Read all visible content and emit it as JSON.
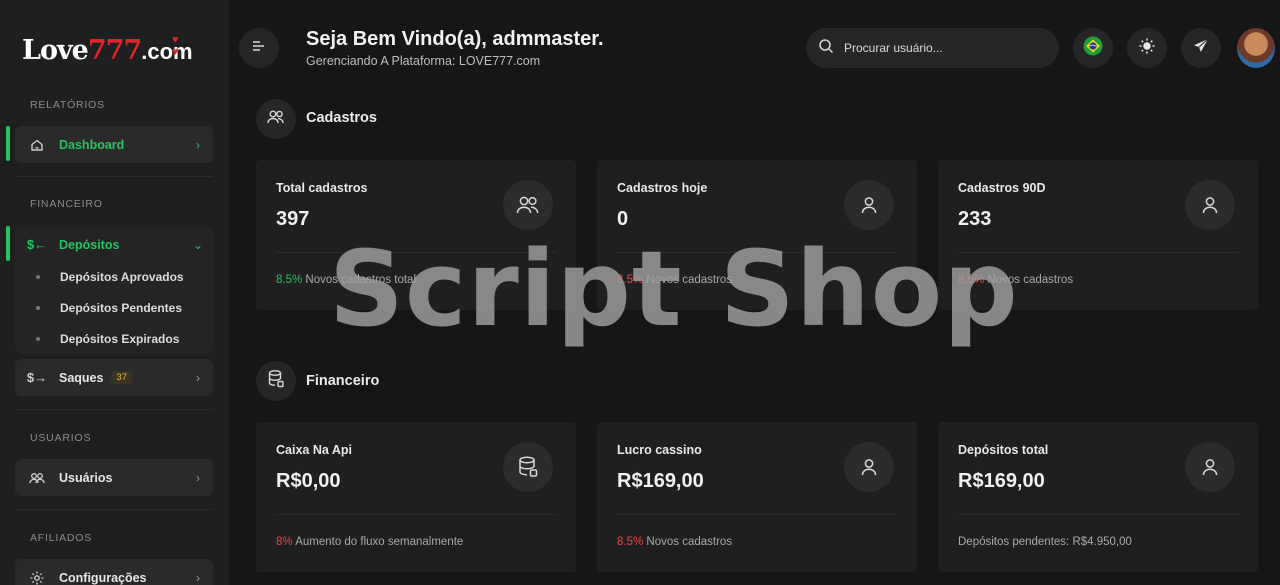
{
  "brand": {
    "logo_main": "Love",
    "logo_num": "777",
    "logo_tld": ".com",
    "logo_hearts": "♥ ♥"
  },
  "sidebar": {
    "sections": {
      "relatorios": "RELATÓRIOS",
      "financeiro": "FINANCEIRO",
      "usuarios": "USUARIOS",
      "afiliados": "AFILIADOS"
    },
    "dashboard": "Dashboard",
    "depositos": "Depósitos",
    "depositos_sub": [
      "Depósitos Aprovados",
      "Depósitos Pendentes",
      "Depósitos Expirados"
    ],
    "saques": "Saques",
    "saques_badge": "37",
    "usuarios": "Usuários",
    "configuracoes": "Configurações"
  },
  "header": {
    "greeting": "Seja Bem Vindo(a), admmaster.",
    "subtitle": "Gerenciando A Plataforma: LOVE777.com",
    "search_placeholder": "Procurar usuário..."
  },
  "cadastros": {
    "title": "Cadastros",
    "cards": [
      {
        "title": "Total cadastros",
        "value": "397",
        "pct": "8.5%",
        "note": "Novos cadastros total"
      },
      {
        "title": "Cadastros hoje",
        "value": "0",
        "pct": "8.5%",
        "note": "Novos cadastros"
      },
      {
        "title": "Cadastros 90D",
        "value": "233",
        "pct": "8.5%",
        "note": "Novos cadastros"
      }
    ]
  },
  "financeiro": {
    "title": "Financeiro",
    "cards": [
      {
        "title": "Caixa Na Api",
        "value": "R$0,00",
        "pct": "8%",
        "note": "Aumento do fluxo semanalmente"
      },
      {
        "title": "Lucro cassino",
        "value": "R$169,00",
        "pct": "8.5%",
        "note": "Novos cadastros"
      },
      {
        "title": "Depósitos total",
        "value": "R$169,00",
        "note": "Depósitos pendentes: R$4.950,00"
      }
    ]
  },
  "watermark": "Script Shop",
  "colors": {
    "accent": "#22c55e",
    "negative": "#ef4444",
    "badge": "#e9b949"
  },
  "icons": [
    "menu-icon",
    "search-icon",
    "brazil-flag-icon",
    "sun-icon",
    "rocket-icon",
    "users-icon",
    "user-icon",
    "database-icon",
    "home-icon",
    "deposit-icon",
    "withdraw-icon",
    "gear-icon"
  ]
}
